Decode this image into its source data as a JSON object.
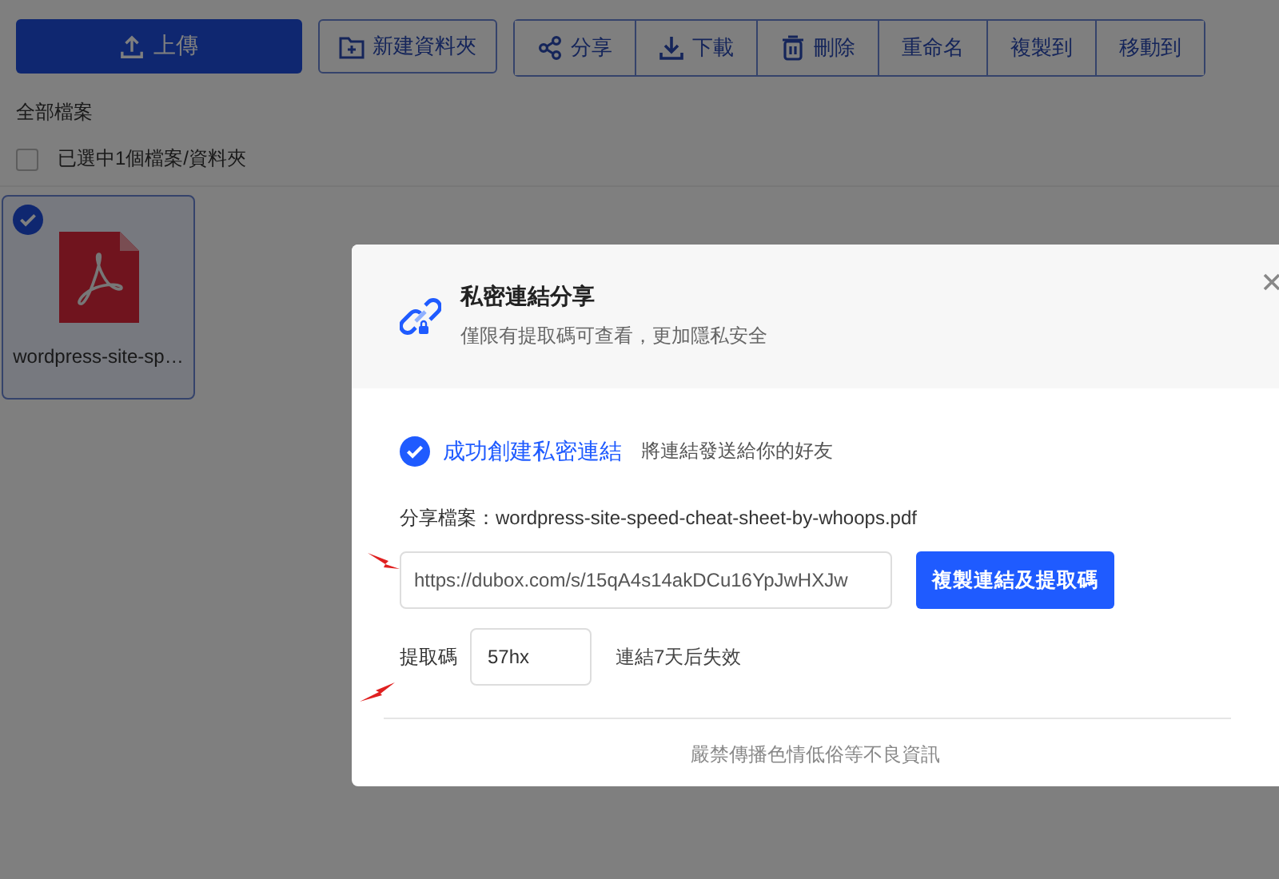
{
  "toolbar": {
    "upload": "上傳",
    "new_folder": "新建資料夾",
    "actions": [
      {
        "label": "分享",
        "kind": "share"
      },
      {
        "label": "下載",
        "kind": "download"
      },
      {
        "label": "刪除",
        "kind": "delete"
      },
      {
        "label": "重命名",
        "kind": "text"
      },
      {
        "label": "複製到",
        "kind": "text"
      },
      {
        "label": "移動到",
        "kind": "text"
      }
    ]
  },
  "breadcrumb": "全部檔案",
  "selection": {
    "checked": false,
    "label": "已選中1個檔案/資料夾"
  },
  "files": [
    {
      "name": "wordpress-site-sp…",
      "kind": "pdf",
      "selected": true
    }
  ],
  "dialog": {
    "title": "私密連結分享",
    "subtitle": "僅限有提取碼可查看，更加隱私安全",
    "success": "成功創建私密連結",
    "success_hint": "將連結發送給你的好友",
    "file_label": "分享檔案：",
    "file_name": "wordpress-site-speed-cheat-sheet-by-whoops.pdf",
    "link": "https://dubox.com/s/15qA4s14akDCu16YpJwHXJw",
    "copy_button": "複製連結及提取碼",
    "code_label": "提取碼",
    "code": "57hx",
    "expiry": "連結7天后失效",
    "footer": "嚴禁傳播色情低俗等不良資訊"
  }
}
